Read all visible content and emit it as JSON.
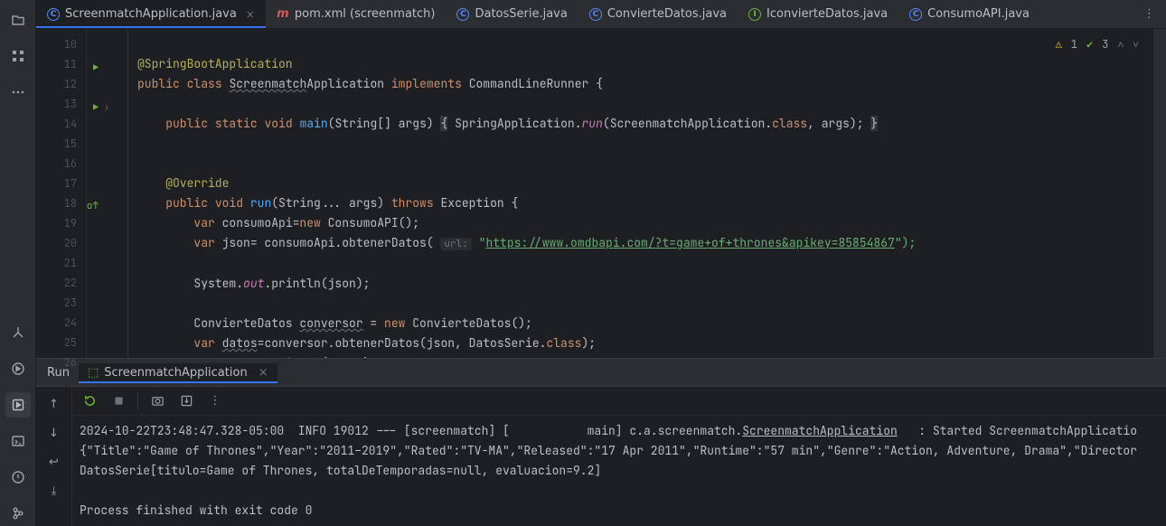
{
  "tabs": [
    {
      "label": "ScreenmatchApplication.java",
      "kind": "java-c",
      "closable": true,
      "active": true
    },
    {
      "label": "pom.xml (screenmatch)",
      "kind": "maven",
      "closable": false,
      "active": false
    },
    {
      "label": "DatosSerie.java",
      "kind": "java-c",
      "closable": false,
      "active": false
    },
    {
      "label": "ConvierteDatos.java",
      "kind": "java-c",
      "closable": false,
      "active": false
    },
    {
      "label": "IconvierteDatos.java",
      "kind": "java-i",
      "closable": false,
      "active": false
    },
    {
      "label": "ConsumoAPI.java",
      "kind": "java-c",
      "closable": false,
      "active": false
    }
  ],
  "inspections": {
    "warnings": "1",
    "passed": "3"
  },
  "gutter": {
    "start": 10,
    "end": 26,
    "run_lines": [
      11,
      13
    ],
    "override_lines": [
      18
    ],
    "fold_lines": [
      13
    ]
  },
  "code": {
    "l10": {
      "ann": "@SpringBootApplication"
    },
    "l11": {
      "kw1": "public",
      "kw2": "class",
      "cls": "Screenmatch",
      "suffix": "Application ",
      "kw3": "implements",
      "iface": " CommandLineRunner {"
    },
    "l13": {
      "pre": "    ",
      "kw1": "public",
      "kw2": "static",
      "kw3": "void",
      "fn": "main",
      "args": "(String[] args) ",
      "b1": "{",
      "body1": " SpringApplication.",
      "run_i": "run",
      "body2": "(ScreenmatchApplication.",
      "cls_kw": "class",
      "body3": ", args); ",
      "b2": "}"
    },
    "l17": {
      "pre": "    ",
      "ann": "@Override"
    },
    "l18": {
      "pre": "    ",
      "kw1": "public",
      "kw2": "void",
      "fn": "run",
      "args": "(String... args) ",
      "kw3": "throws",
      "exc": " Exception {"
    },
    "l19": {
      "pre": "        ",
      "kw": "var",
      "var": " consumoApi=",
      "kw2": "new",
      "rest": " ConsumoAPI();"
    },
    "l20": {
      "pre": "        ",
      "kw": "var",
      "var": " json= consumoApi.obtenerDatos( ",
      "hint": "url:",
      "q": " \"",
      "url": "https://www.omdbapi.com/?t=game+of+thrones&apikey=85854867",
      "q2": "\");"
    },
    "l22": {
      "pre": "        ",
      "a": "System.",
      "out": "out",
      "b": ".println(json);"
    },
    "l24": {
      "pre": "        ",
      "a": "ConvierteDatos ",
      "u": "conversor",
      "b": " = ",
      "kw": "new",
      "c": " ConvierteDatos();"
    },
    "l25": {
      "pre": "        ",
      "kw": "var",
      "sp": " ",
      "u": "datos",
      "a": "=conversor.obtenerDatos(json, DatosSerie.",
      "cls": "class",
      "b": ");"
    },
    "l26": {
      "pre": "        ",
      "a": "System.",
      "out": "out",
      "b": ".println(datos);"
    }
  },
  "run": {
    "title": "Run",
    "config": "ScreenmatchApplication",
    "console": [
      "2024-10-22T23:48:47.328-05:00  INFO 19012 --- [screenmatch] [           main] c.a.screenmatch.ScreenmatchApplication   : Started ScreenmatchApplicatio",
      "{\"Title\":\"Game of Thrones\",\"Year\":\"2011–2019\",\"Rated\":\"TV-MA\",\"Released\":\"17 Apr 2011\",\"Runtime\":\"57 min\",\"Genre\":\"Action, Adventure, Drama\",\"Director",
      "DatosSerie[titulo=Game of Thrones, totalDeTemporadas=null, evaluacion=9.2]",
      "",
      "Process finished with exit code 0"
    ],
    "link_part": "ScreenmatchApplication"
  }
}
